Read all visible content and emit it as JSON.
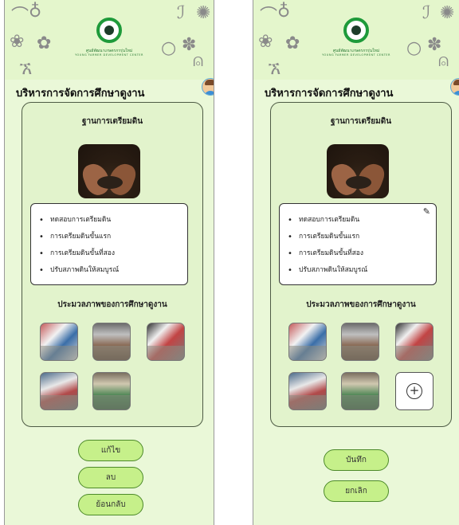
{
  "brand": {
    "name": "ศูนย์พัฒนาเกษตรกรรุ่นใหม่",
    "tagline": "YOUNG FARMER DEVELOPMENT CENTER",
    "accent": "#1e9a3a"
  },
  "header": {
    "title": "บริหารการจัดการศึกษาดูงาน"
  },
  "colors": {
    "background": "#eaf8d8",
    "panel": "#e2f3cc",
    "button": "#c6f08a",
    "button_border": "#4d8a2a"
  },
  "station": {
    "title": "ฐานการเตรียมดิน",
    "topics": [
      "ทดสอบการเตรียมดิน",
      "การเตรียมดินขั้นแรก",
      "การเตรียมดินขั้นที่สอง",
      "ปรับสภาพดินให้สมบูรณ์"
    ],
    "gallery_title": "ประมวลภาพของการศึกษาดูงาน"
  },
  "view_screen": {
    "buttons": {
      "edit": "แก้ไข",
      "delete": "ลบ",
      "back": "ย้อนกลับ"
    }
  },
  "edit_screen": {
    "edit_icon": "pencil-icon",
    "add_icon": "plus-circle-icon",
    "buttons": {
      "save": "บันทึก",
      "cancel": "ยกเลิก"
    }
  }
}
